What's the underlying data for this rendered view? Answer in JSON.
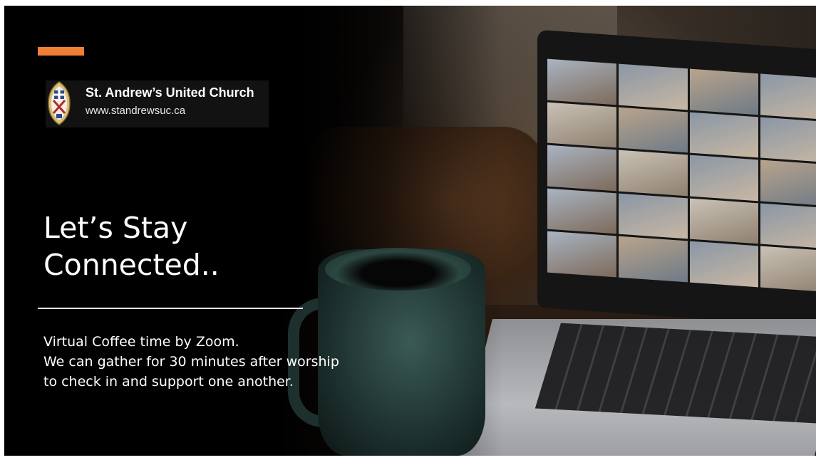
{
  "colors": {
    "accent": "#f07f36",
    "background": "#000000",
    "text": "#ffffff"
  },
  "logo": {
    "name": "St. Andrew’s United Church",
    "url": "www.standrewsuc.ca",
    "icon": "church-crest-icon"
  },
  "headline": {
    "line1": "Let’s Stay",
    "line2": "Connected.."
  },
  "body": {
    "line1": "Virtual Coffee time by Zoom.",
    "line2": "We can gather for 30 minutes after worship",
    "line3": "to check in and support one another."
  }
}
